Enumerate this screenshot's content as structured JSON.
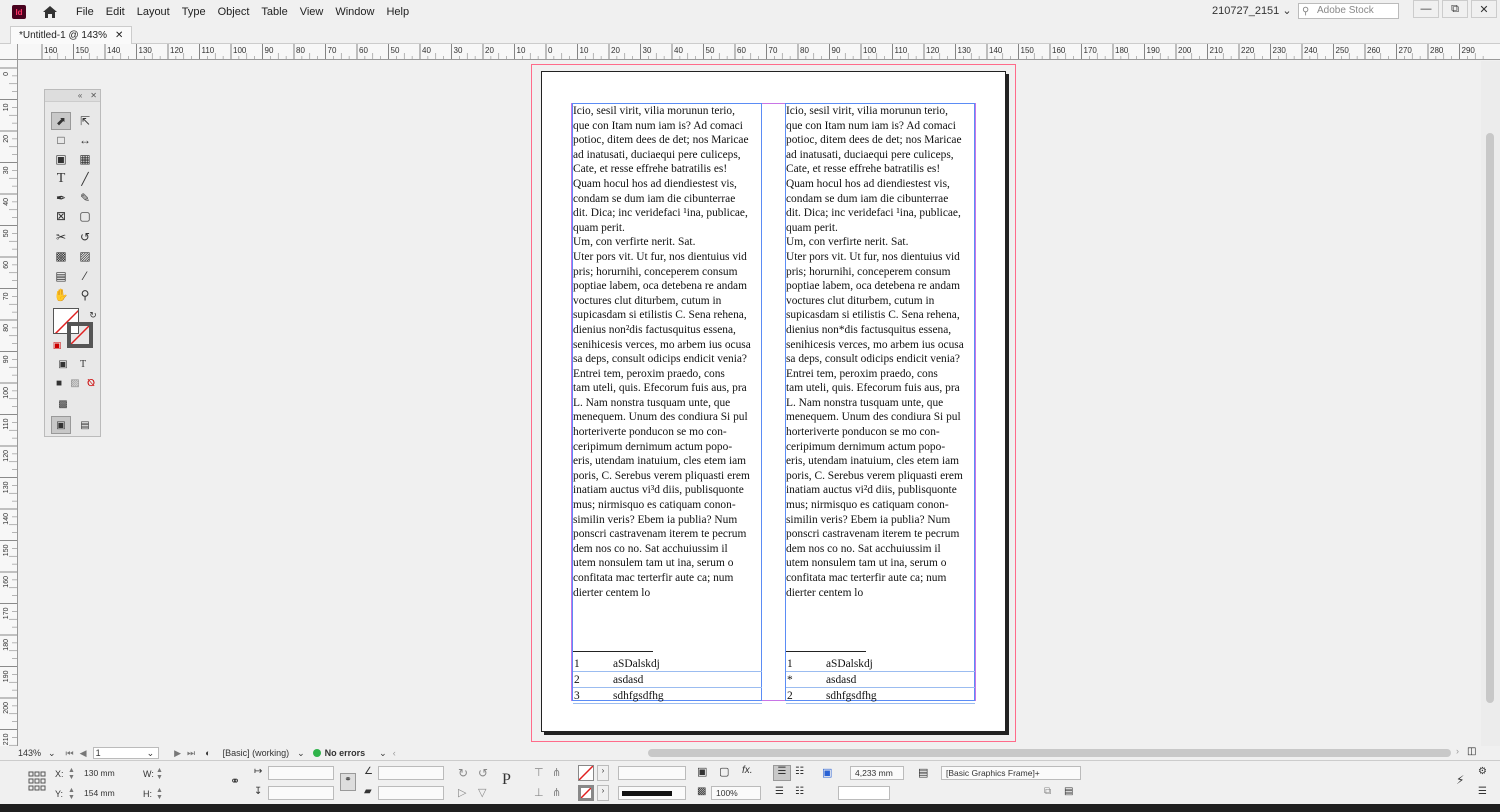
{
  "app": {
    "menu": [
      "File",
      "Edit",
      "Layout",
      "Type",
      "Object",
      "Table",
      "View",
      "Window",
      "Help"
    ],
    "workspace": "210727_2151",
    "stock_search_placeholder": "Adobe Stock"
  },
  "document": {
    "tab_title": "*Untitled-1 @ 143%"
  },
  "ruler": {
    "h_labels": [
      "160",
      "150",
      "140",
      "130",
      "120",
      "110",
      "100",
      "90",
      "80",
      "70",
      "60",
      "50",
      "40",
      "30",
      "20",
      "10",
      "0",
      "10",
      "20",
      "30",
      "40",
      "50",
      "60",
      "70",
      "80",
      "90",
      "100",
      "110",
      "120",
      "130",
      "140",
      "150",
      "160",
      "170",
      "180",
      "190",
      "200",
      "210",
      "220",
      "230",
      "240",
      "250",
      "260",
      "270",
      "280",
      "290"
    ],
    "v_labels": [
      "0",
      "10",
      "20",
      "30",
      "40",
      "50",
      "60",
      "70",
      "80",
      "90",
      "100",
      "110",
      "120",
      "130",
      "140",
      "150",
      "160",
      "170",
      "180",
      "190",
      "200",
      "210"
    ]
  },
  "frames": {
    "left": {
      "lines": [
        "Icio, sesil virit, vilia morunun terio,",
        "que con Itam num iam is? Ad comaci",
        "potioc, ditem dees de det; nos Maricae",
        "ad inatusati, duciaequi pere culiceps,",
        "Cate, et resse effrehe batratilis es!",
        "Quam hocul hos ad diendiestest vis,",
        "condam se dum iam die cibunterrae",
        "dit. Dica; inc veridefaci ¹ina, publicae,",
        "quam perit.",
        "Um, con verfirte nerit. Sat.",
        "Uter pors vit. Ut fur, nos dientuius vid",
        "pris; horurnihi, conceperem consum",
        "poptiae labem, oca detebena re andam",
        "voctures clut diturbem, cutum in",
        "supicasdam si etilistis C. Sena rehena,",
        "dienius non²dis factusquitus essena,",
        "senihicesis verces, mo arbem ius ocusa",
        "sa deps, consult odicips endicit venia?",
        "Entrei tem, peroxim praedo, cons",
        "tam uteli, quis. Efecorum fuis aus, pra",
        "L. Nam nonstra tusquam unte, que",
        "menequem. Unum des condiura Si pul",
        "horteriverte ponducon se mo con-",
        "ceripimum dernimum actum popo-",
        "eris, utendam inatuium, cles etem iam",
        "poris, C. Serebus verem pliquasti erem",
        "inatiam auctus vi³d diis, publisquonte",
        "mus; nirmisquo es catiquam conon-",
        "similin veris? Ebem ia publia? Num",
        "ponscri castravenam iterem te pecrum",
        "dem nos co no. Sat acchuiussim il",
        "utem nonsulem tam ut ina, serum o",
        "confitata mac terterfir aute ca; num",
        "dierter centem lo"
      ],
      "footnotes": [
        {
          "num": "1",
          "text": "aSDalskdj"
        },
        {
          "num": "2",
          "text": "asdasd"
        },
        {
          "num": "3",
          "text": "sdhfgsdfhg"
        }
      ]
    },
    "right": {
      "lines": [
        "Icio, sesil virit, vilia morunun terio,",
        "que con Itam num iam is? Ad comaci",
        "potioc, ditem dees de det; nos Maricae",
        "ad inatusati, duciaequi pere culiceps,",
        "Cate, et resse effrehe batratilis es!",
        "Quam hocul hos ad diendiestest vis,",
        "condam se dum iam die cibunterrae",
        "dit. Dica; inc veridefaci ¹ina, publicae,",
        "quam perit.",
        "Um, con verfirte nerit. Sat.",
        "Uter pors vit. Ut fur, nos dientuius vid",
        "pris; horurnihi, conceperem consum",
        "poptiae labem, oca detebena re andam",
        "voctures clut diturbem, cutum in",
        "supicasdam si etilistis C. Sena rehena,",
        "dienius non*dis factusquitus essena,",
        "senihicesis verces, mo arbem ius ocusa",
        "sa deps, consult odicips endicit venia?",
        "Entrei tem, peroxim praedo, cons",
        "tam uteli, quis. Efecorum fuis aus, pra",
        "L. Nam nonstra tusquam unte, que",
        "menequem. Unum des condiura Si pul",
        "horteriverte ponducon se mo con-",
        "ceripimum dernimum actum popo-",
        "eris, utendam inatuium, cles etem iam",
        "poris, C. Serebus verem pliquasti erem",
        "inatiam auctus vi²d diis, publisquonte",
        "mus; nirmisquo es catiquam conon-",
        "similin veris? Ebem ia publia? Num",
        "ponscri castravenam iterem te pecrum",
        "dem nos co no. Sat acchuiussim il",
        "utem nonsulem tam ut ina, serum o",
        "confitata mac terterfir aute ca; num",
        "dierter centem lo"
      ],
      "footnotes": [
        {
          "num": "1",
          "text": "aSDalskdj"
        },
        {
          "num": "*",
          "text": "asdasd"
        },
        {
          "num": "2",
          "text": "sdhfgsdfhg"
        }
      ]
    }
  },
  "status": {
    "zoom": "143%",
    "page_number": "1",
    "preflight_profile": "[Basic] (working)",
    "errors": "No errors"
  },
  "control_panel": {
    "x_label": "X:",
    "x_value": "130 mm",
    "y_label": "Y:",
    "y_value": "154 mm",
    "w_label": "W:",
    "h_label": "H:",
    "opacity": "100%",
    "gap_value": "4,233 mm",
    "object_style": "[Basic Graphics Frame]+"
  },
  "colors": {
    "bleed_guide": "#ff6b8a",
    "margin_guide": "#c875e6",
    "frame_edge": "#5b8cf5",
    "app_accent": "#ff3366"
  }
}
